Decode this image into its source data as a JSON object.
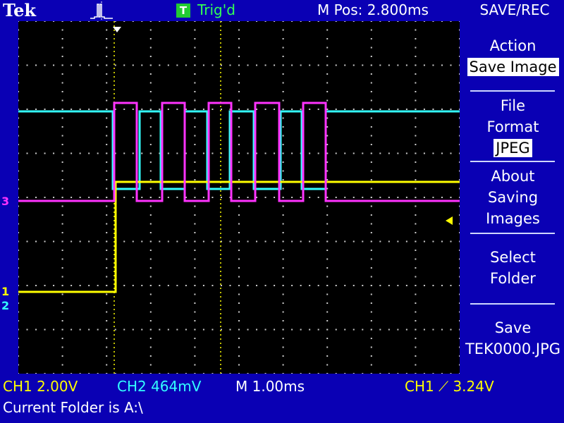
{
  "header": {
    "brand": "Tek",
    "acquisition_icon": "pulse-icon",
    "trigger_badge": "T",
    "trigger_status": "Trig'd",
    "horizontal_position": "M Pos: 2.800ms",
    "menu_title": "SAVE/REC"
  },
  "channels": {
    "ch1": {
      "marker": "1",
      "color": "#ffff00"
    },
    "ch2": {
      "marker": "2",
      "color": "#33ffff"
    },
    "ch3": {
      "marker": "3",
      "color": "#ff33ff"
    }
  },
  "side_menu": {
    "action_label": "Action",
    "action_value": "Save Image",
    "file_format_line1": "File",
    "file_format_line2": "Format",
    "file_format_value": "JPEG",
    "about_line1": "About",
    "about_line2": "Saving",
    "about_line3": "Images",
    "select_line1": "Select",
    "select_line2": "Folder",
    "save_line1": "Save",
    "save_line2": "TEK0000.JPG"
  },
  "status": {
    "ch1_scale": "CH1  2.00V",
    "ch2_scale": "CH2  464mV",
    "time_scale": "M 1.00ms",
    "trigger_readout": "CH1 ⟋ 3.24V",
    "current_folder": "Current Folder is A:\\"
  },
  "colors": {
    "background": "#0a00b4",
    "ch1": "#ffff00",
    "ch2": "#33ffff",
    "ch3": "#ff33ff",
    "trigger_ok": "#22cc33"
  }
}
